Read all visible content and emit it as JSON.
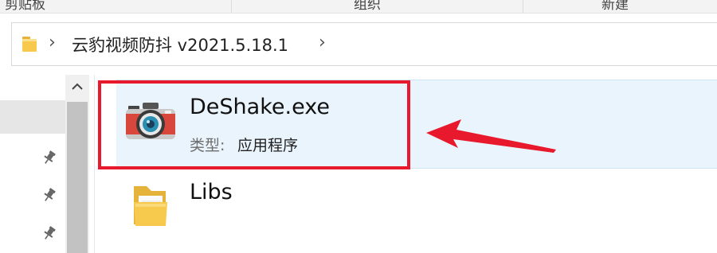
{
  "ribbon": {
    "groups": [
      "剪贴板",
      "组织",
      "新建"
    ]
  },
  "address_bar": {
    "path": "云豹视频防抖 v2021.5.18.1",
    "separator": "›"
  },
  "files": [
    {
      "name": "DeShake.exe",
      "type_label": "类型:",
      "type_value": "应用程序",
      "icon": "camera-icon",
      "selected": true
    },
    {
      "name": "Libs",
      "icon": "folder-icon"
    }
  ],
  "colors": {
    "highlight": "#e8192c",
    "selection_bg": "#eaf4fc",
    "folder": "#f7c94d"
  }
}
